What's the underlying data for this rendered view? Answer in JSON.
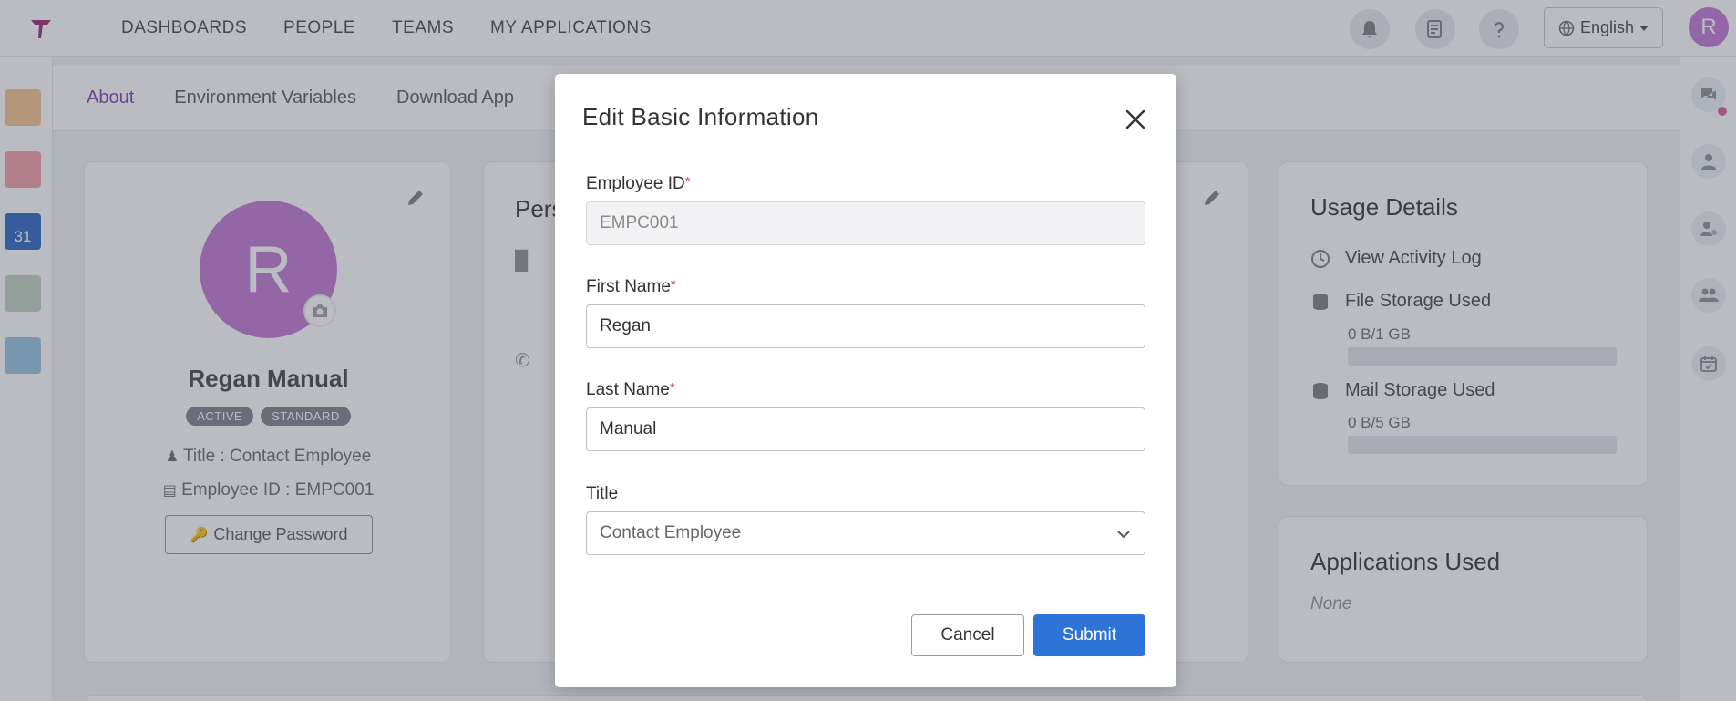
{
  "nav": {
    "items": [
      "DASHBOARDS",
      "PEOPLE",
      "TEAMS",
      "MY APPLICATIONS"
    ],
    "language": "English",
    "user_initial": "R"
  },
  "subtabs": [
    "About",
    "Environment Variables",
    "Download App"
  ],
  "profile": {
    "initial": "R",
    "name": "Regan Manual",
    "badges": [
      "ACTIVE",
      "STANDARD"
    ],
    "title_line": "Title : Contact Employee",
    "employee_id_line": "Employee ID : EMPC001",
    "change_password": "Change Password"
  },
  "personal": {
    "title_partial": "Pers"
  },
  "usage": {
    "title": "Usage Details",
    "activity_log": "View Activity Log",
    "file_storage_label": "File Storage Used",
    "file_storage_value": "0 B/1 GB",
    "mail_storage_label": "Mail Storage Used",
    "mail_storage_value": "0 B/5 GB",
    "file_storage_fraction": 0,
    "mail_storage_fraction": 0
  },
  "applications": {
    "title": "Applications Used",
    "empty_text": "None"
  },
  "modal": {
    "title": "Edit Basic Information",
    "employee_id_label": "Employee ID",
    "employee_id_value": "EMPC001",
    "first_name_label": "First Name",
    "first_name_value": "Regan",
    "last_name_label": "Last Name",
    "last_name_value": "Manual",
    "title_label": "Title",
    "title_value": "Contact Employee",
    "required_mark": "*",
    "cancel_label": "Cancel",
    "submit_label": "Submit"
  },
  "colors": {
    "accent": "#8b4fb8",
    "avatar": "#c680d6",
    "primary_button": "#2e73d6",
    "required": "#e03a3a"
  }
}
